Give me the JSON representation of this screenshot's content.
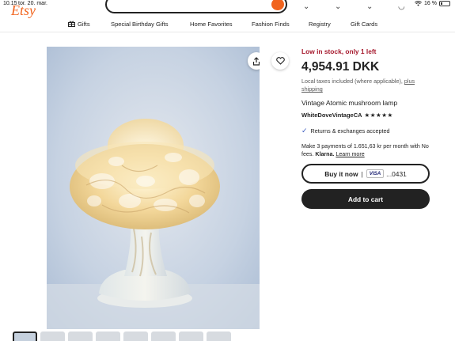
{
  "status_bar": {
    "time": "10.15",
    "date": "tor. 20. mar.",
    "dots": "•••",
    "battery": "16 %"
  },
  "nav": {
    "items": [
      {
        "label": "Gifts"
      },
      {
        "label": "Special Birthday Gifts"
      },
      {
        "label": "Home Favorites"
      },
      {
        "label": "Fashion Finds"
      },
      {
        "label": "Registry"
      },
      {
        "label": "Gift Cards"
      }
    ]
  },
  "product": {
    "stock_notice": "Low in stock, only 1 left",
    "price": "4,954.91 DKK",
    "tax_note": "Local taxes included (where applicable), ",
    "tax_link": "plus shipping",
    "title": "Vintage Atomic mushroom lamp",
    "shop_name": "WhiteDoveVintageCA",
    "rating_stars": "★★★★★",
    "returns": "Returns & exchanges accepted",
    "installments_text": "Make 3 payments of 1.651,63 kr per month with No fees. ",
    "klarna_brand": "Klarna.",
    "klarna_link": "Learn more"
  },
  "buttons": {
    "buy_now": "Buy it now",
    "buy_sep": "|",
    "card_brand": "VISA",
    "card_last4": "...0431",
    "add_to_cart": "Add to cart"
  },
  "icons": {
    "share": "share-icon",
    "favorite": "heart-icon",
    "gift": "gift-icon",
    "check": "check-icon"
  },
  "colors": {
    "brand": "#f1641e",
    "stock": "#a61a2e",
    "button_dark": "#222222",
    "check": "#3a5bbf"
  }
}
